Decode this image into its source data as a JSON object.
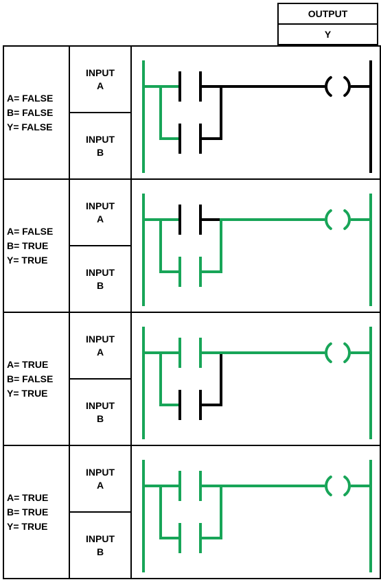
{
  "header": {
    "output_label": "OUTPUT",
    "output_y": "Y"
  },
  "labels": {
    "input_a": "INPUT",
    "input_a_name": "A",
    "input_b": "INPUT",
    "input_b_name": "B"
  },
  "rows": [
    {
      "a_line": "A= FALSE",
      "b_line": "B= FALSE",
      "y_line": "Y= FALSE",
      "a_energized": false,
      "b_energized": false,
      "y_energized": false
    },
    {
      "a_line": "A= FALSE",
      "b_line": "B= TRUE",
      "y_line": "Y= TRUE",
      "a_energized": false,
      "b_energized": true,
      "y_energized": true
    },
    {
      "a_line": "A= TRUE",
      "b_line": "B= FALSE",
      "y_line": "Y= TRUE",
      "a_energized": true,
      "b_energized": false,
      "y_energized": true
    },
    {
      "a_line": "A= TRUE",
      "b_line": "B= TRUE",
      "y_line": "Y= TRUE",
      "a_energized": true,
      "b_energized": true,
      "y_energized": true
    }
  ],
  "colors": {
    "on": "#18A558",
    "off": "#000000"
  }
}
